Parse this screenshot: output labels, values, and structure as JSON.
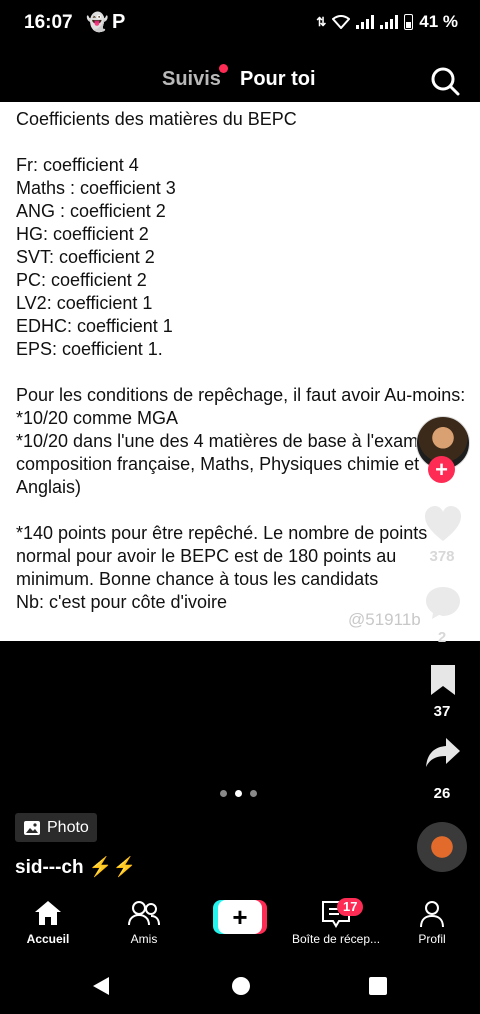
{
  "status_bar": {
    "time": "16:07",
    "battery": "41 %"
  },
  "top_nav": {
    "following": "Suivis",
    "for_you": "Pour toi"
  },
  "post": {
    "text": "Coefficients des matières du BEPC\n\nFr: coefficient 4\nMaths : coefficient 3\nANG : coefficient 2\nHG: coefficient 2\nSVT: coefficient 2\nPC: coefficient 2\nLV2: coefficient 1\nEDHC: coefficient 1\nEPS: coefficient 1.\n\nPour les conditions de repêchage, il faut avoir Au-moins:\n*10/20 comme MGA\n*10/20 dans l'une des 4 matières de base à l'examen ( composition française, Maths, Physiques chimie et Anglais)\n\n*140 points pour être repêché. Le nombre de points normal pour avoir le BEPC est de 180 points au minimum. Bonne chance à tous les candidats\nNb: c'est pour côte d'ivoire",
    "watermark": "@51911b"
  },
  "actions": {
    "likes": "378",
    "comments": "2",
    "bookmarks": "37",
    "shares": "26"
  },
  "photo_label": "Photo",
  "username": "sid---ch ⚡⚡",
  "bottom_nav": {
    "home": "Accueil",
    "friends": "Amis",
    "inbox": "Boîte de récep...",
    "inbox_badge": "17",
    "profile": "Profil"
  },
  "colors": {
    "accent": "#fe2c55",
    "cyan": "#25f4ee"
  }
}
